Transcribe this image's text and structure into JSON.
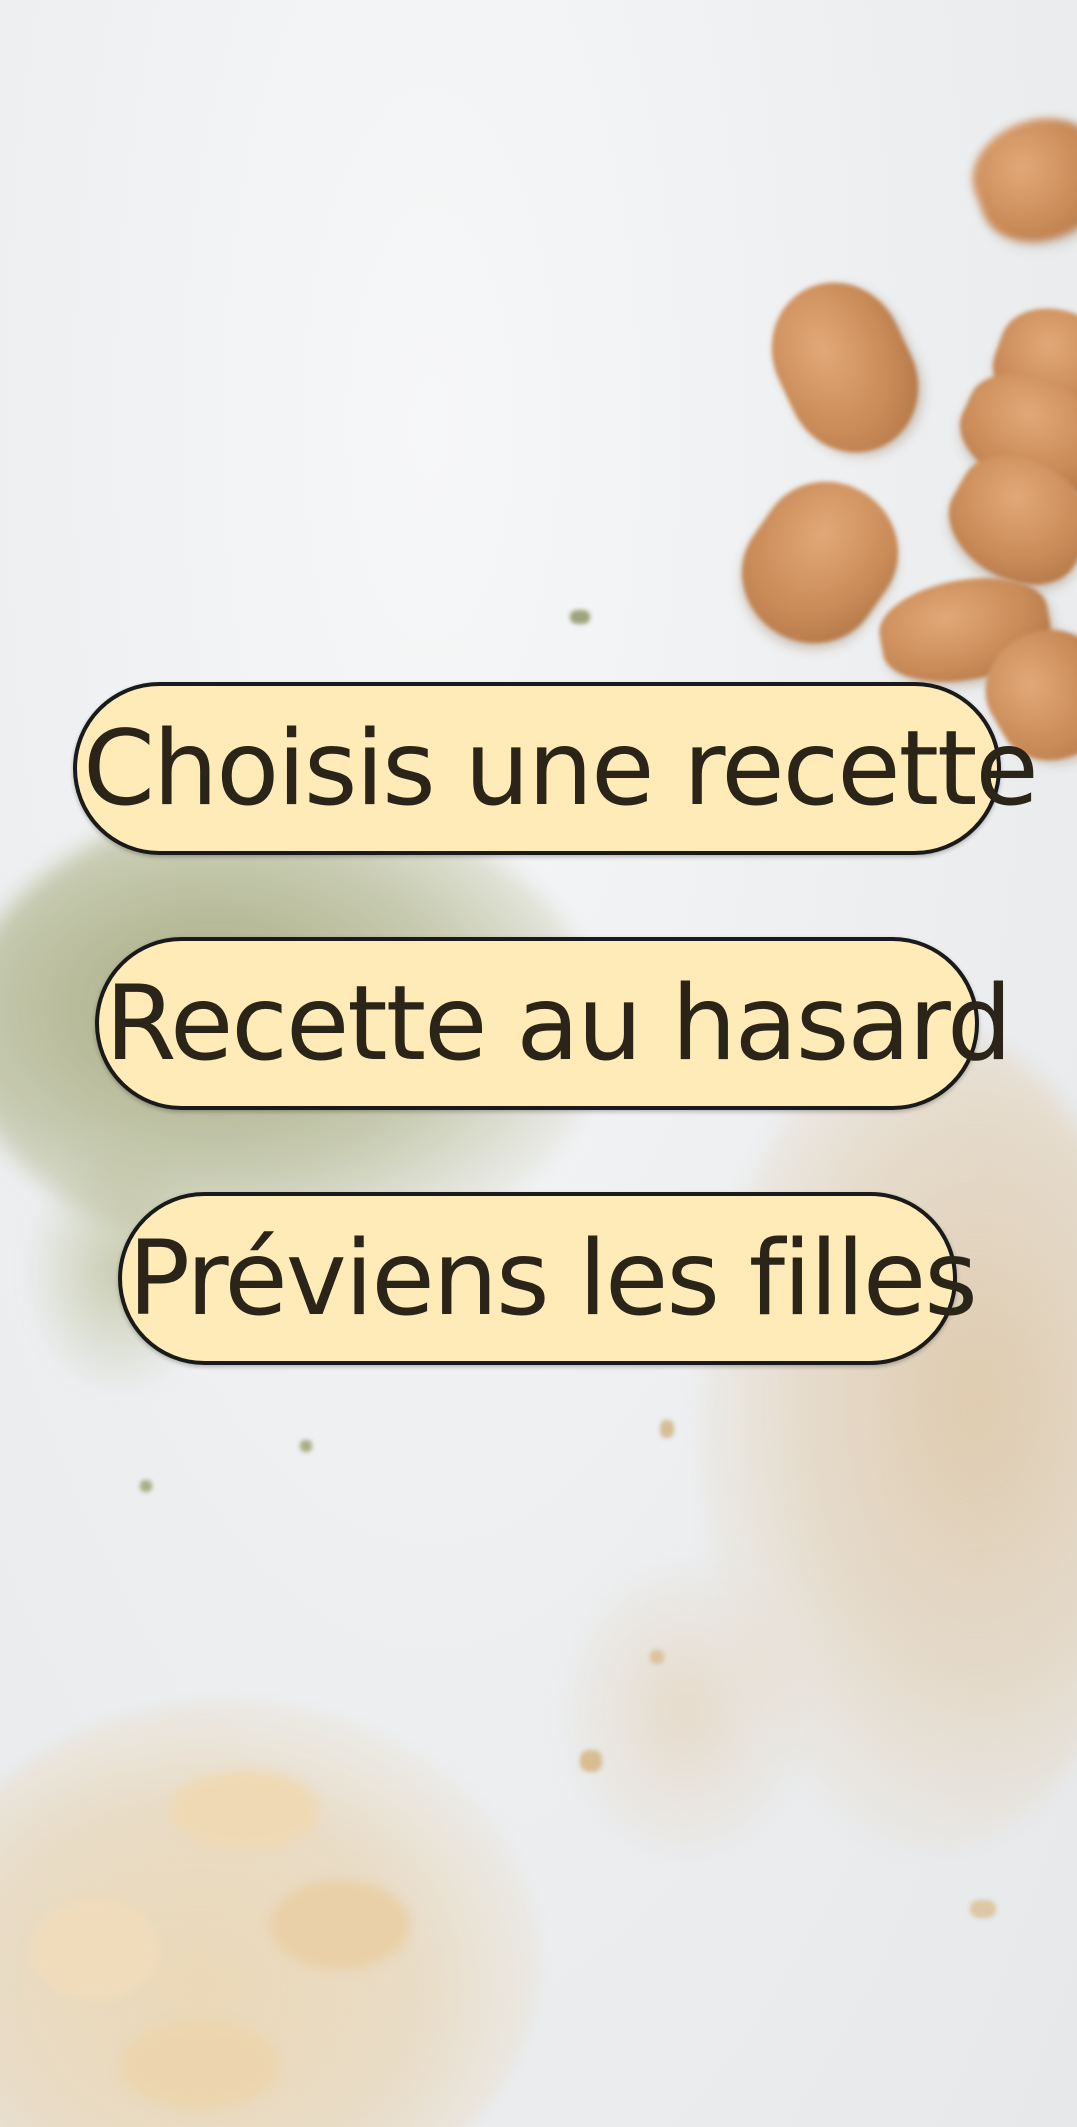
{
  "menu": {
    "choose_recipe_label": "Choisis une recette",
    "random_recipe_label": "Recette au hasard",
    "notify_girls_label": "Préviens les filles"
  },
  "colors": {
    "button_fill": "#feebb8",
    "button_border": "#1a1a1a",
    "button_text": "#2a2419",
    "background": "#eceef0"
  }
}
